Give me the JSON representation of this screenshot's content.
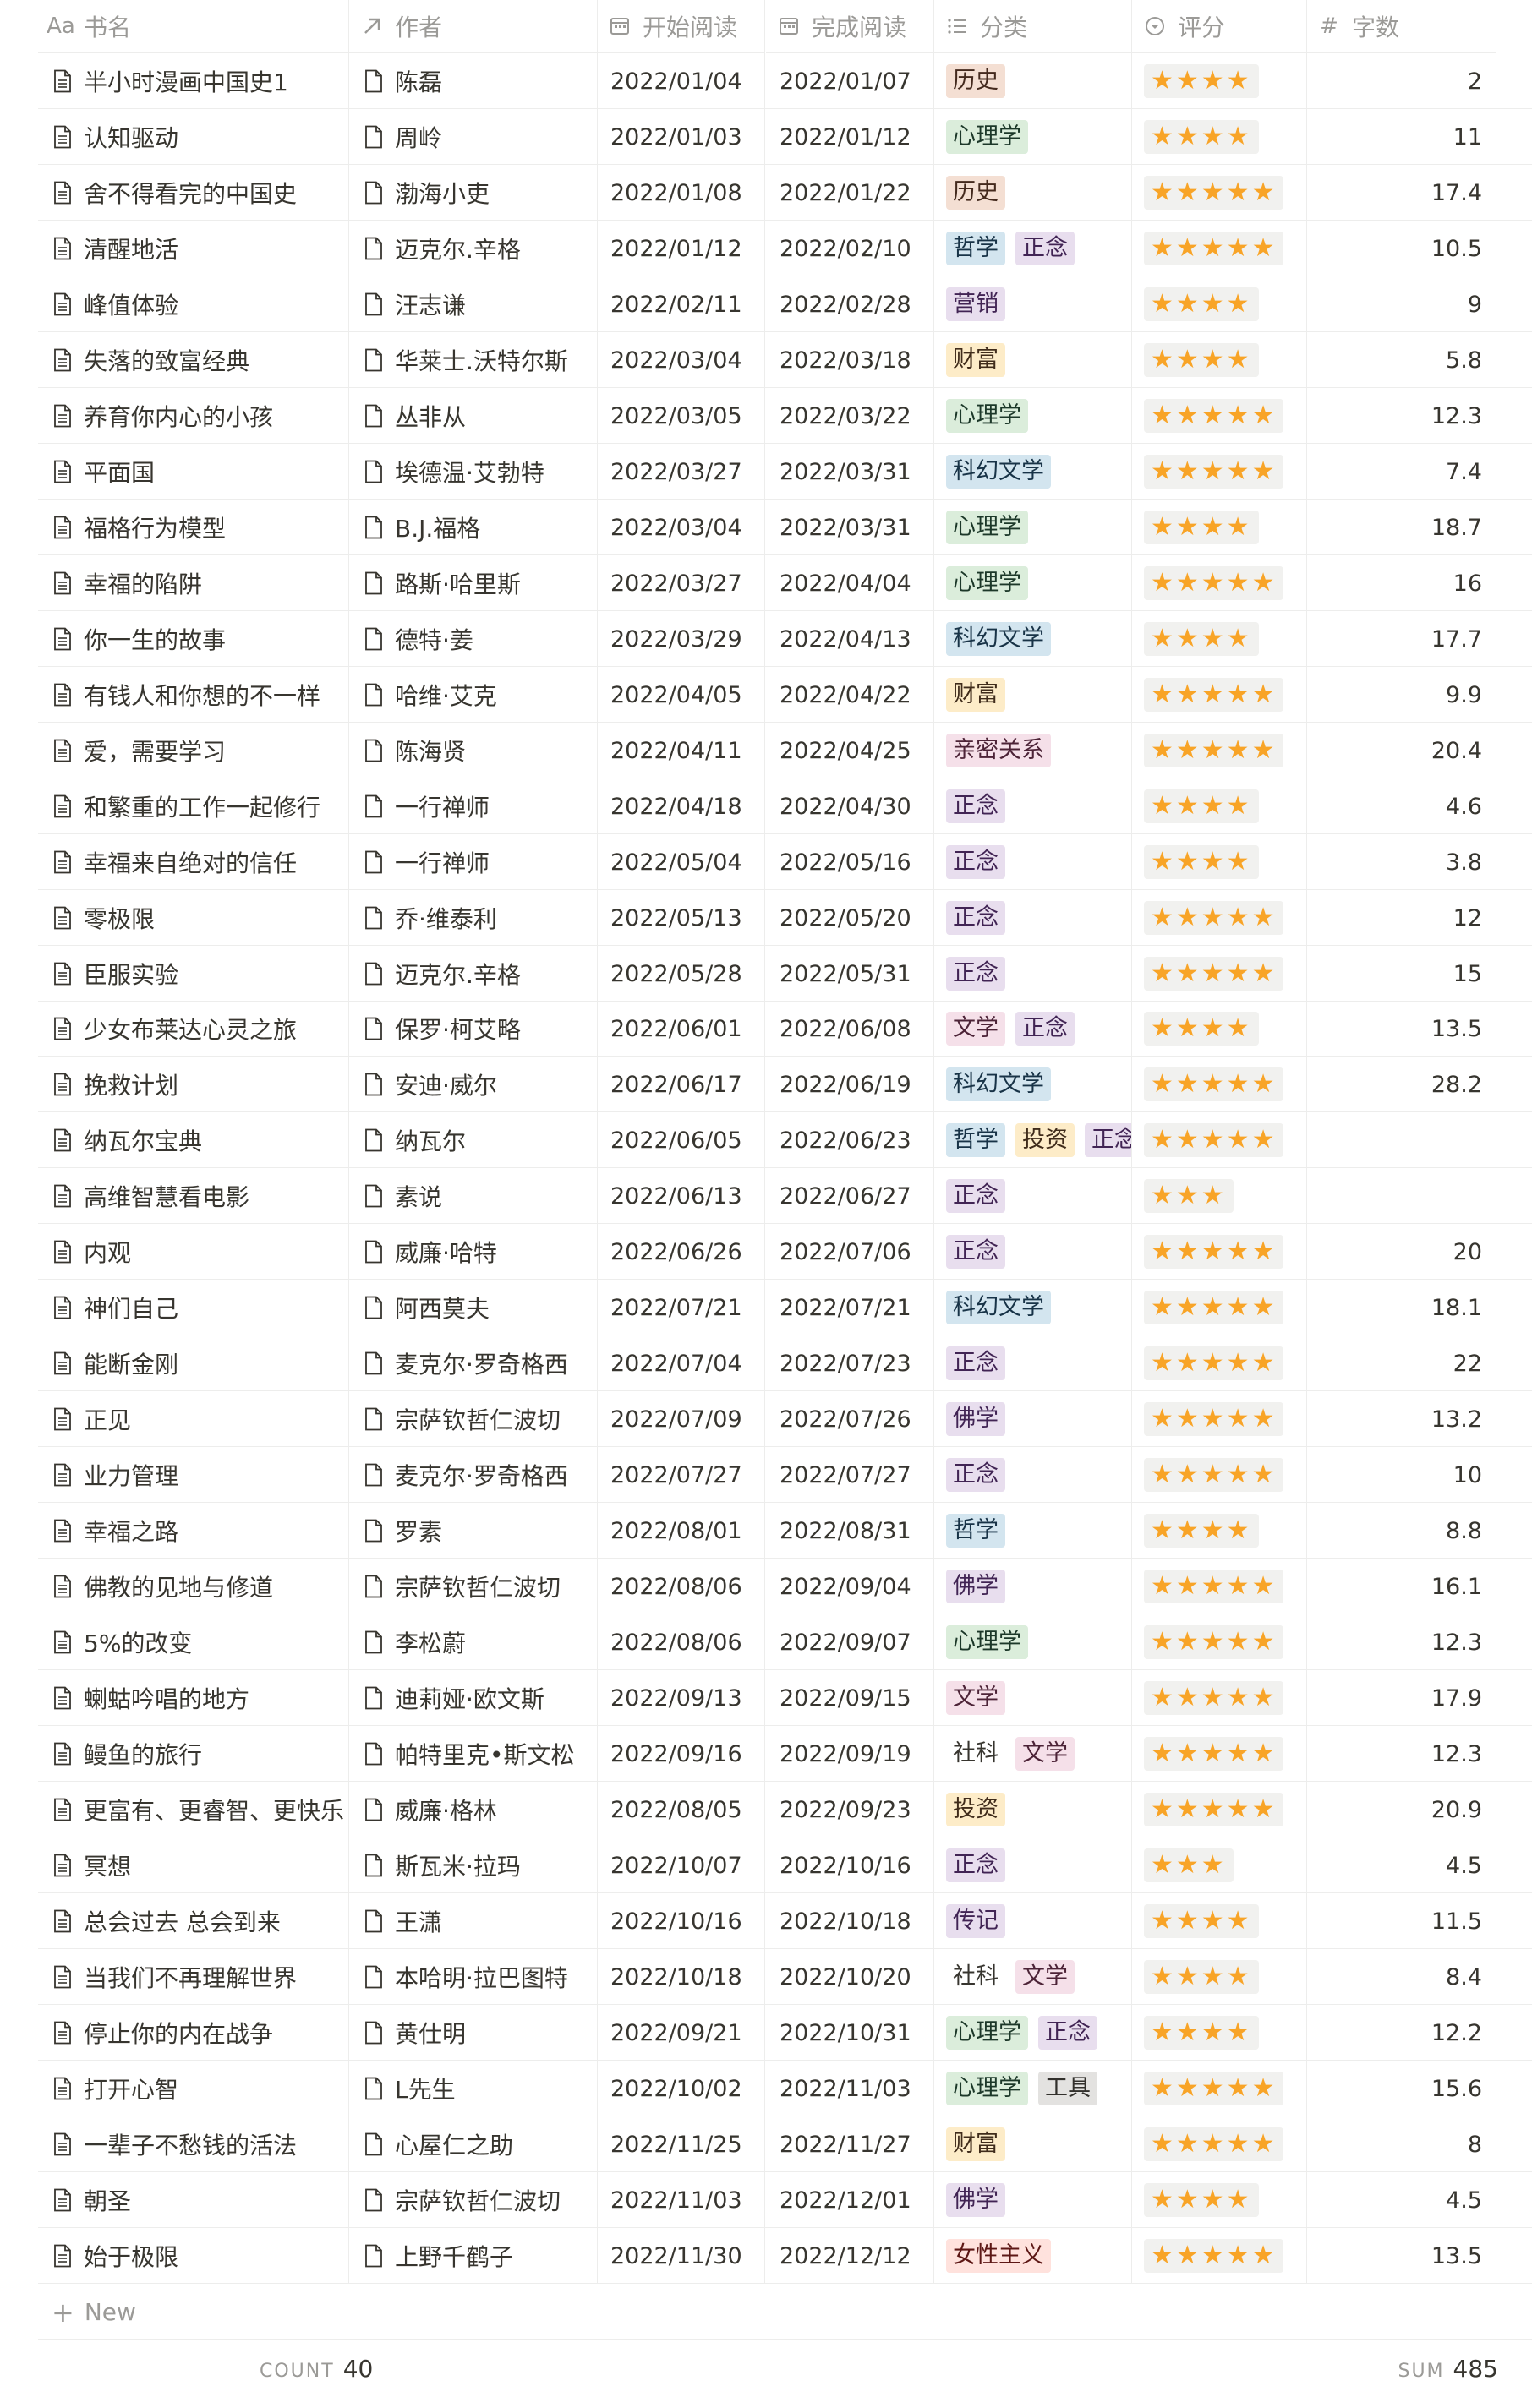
{
  "columns": [
    {
      "key": "title",
      "icon": "text-icon",
      "icon_text": "Aa",
      "label": "书名"
    },
    {
      "key": "author",
      "icon": "relation-arrow-icon",
      "label": "作者"
    },
    {
      "key": "start",
      "icon": "calendar-icon",
      "label": "开始阅读"
    },
    {
      "key": "end",
      "icon": "calendar-icon",
      "label": "完成阅读"
    },
    {
      "key": "category",
      "icon": "list-icon",
      "label": "分类"
    },
    {
      "key": "rating",
      "icon": "select-icon",
      "label": "评分"
    },
    {
      "key": "words",
      "icon": "hash-icon",
      "label": "字数"
    }
  ],
  "tag_colors": {
    "历史": {
      "bg": "#f4dfd3",
      "fg": "#442a1e"
    },
    "心理学": {
      "bg": "#dbeddb",
      "fg": "#1c3829"
    },
    "哲学": {
      "bg": "#d3e5ef",
      "fg": "#183347"
    },
    "正念": {
      "bg": "#e8deee",
      "fg": "#412454"
    },
    "营销": {
      "bg": "#e8deee",
      "fg": "#412454"
    },
    "财富": {
      "bg": "#fdecc8",
      "fg": "#402c1b"
    },
    "科幻文学": {
      "bg": "#d3e5ef",
      "fg": "#183347"
    },
    "亲密关系": {
      "bg": "#f5e0e9",
      "fg": "#4c2337"
    },
    "文学": {
      "bg": "#f5e0e9",
      "fg": "#4c2337"
    },
    "投资": {
      "bg": "#fdecc8",
      "fg": "#402c1b"
    },
    "佛学": {
      "bg": "#e8deee",
      "fg": "#412454"
    },
    "社科": {
      "bg": "#ffffff",
      "fg": "#37352f"
    },
    "传记": {
      "bg": "#e8deee",
      "fg": "#412454"
    },
    "工具": {
      "bg": "#e3e2e0",
      "fg": "#32302c"
    },
    "女性主义": {
      "bg": "#ffe2dd",
      "fg": "#5d1715"
    }
  },
  "rows": [
    {
      "title": "半小时漫画中国史1",
      "author": "陈磊",
      "start": "2022/01/04",
      "end": "2022/01/07",
      "tags": [
        "历史"
      ],
      "stars": "★★★★",
      "rating": 4,
      "words": "2"
    },
    {
      "title": "认知驱动",
      "author": "周岭",
      "start": "2022/01/03",
      "end": "2022/01/12",
      "tags": [
        "心理学"
      ],
      "stars": "★★★★",
      "rating": 4,
      "words": "11"
    },
    {
      "title": "舍不得看完的中国史",
      "author": "渤海小吏",
      "start": "2022/01/08",
      "end": "2022/01/22",
      "tags": [
        "历史"
      ],
      "stars": "★★★★★",
      "rating": 5,
      "words": "17.4"
    },
    {
      "title": "清醒地活",
      "author": "迈克尔.辛格",
      "start": "2022/01/12",
      "end": "2022/02/10",
      "tags": [
        "哲学",
        "正念"
      ],
      "stars": "★★★★★",
      "rating": 5,
      "words": "10.5"
    },
    {
      "title": "峰值体验",
      "author": "汪志谦",
      "start": "2022/02/11",
      "end": "2022/02/28",
      "tags": [
        "营销"
      ],
      "stars": "★★★★",
      "rating": 4,
      "words": "9"
    },
    {
      "title": "失落的致富经典",
      "author": "华莱士.沃特尔斯",
      "start": "2022/03/04",
      "end": "2022/03/18",
      "tags": [
        "财富"
      ],
      "stars": "★★★★",
      "rating": 4,
      "words": "5.8"
    },
    {
      "title": "养育你内心的小孩",
      "author": "丛非从",
      "start": "2022/03/05",
      "end": "2022/03/22",
      "tags": [
        "心理学"
      ],
      "stars": "★★★★★",
      "rating": 5,
      "words": "12.3"
    },
    {
      "title": "平面国",
      "author": "埃德温·艾勃特",
      "start": "2022/03/27",
      "end": "2022/03/31",
      "tags": [
        "科幻文学"
      ],
      "stars": "★★★★★",
      "rating": 5,
      "words": "7.4"
    },
    {
      "title": "福格行为模型",
      "author": "B.J.福格",
      "start": "2022/03/04",
      "end": "2022/03/31",
      "tags": [
        "心理学"
      ],
      "stars": "★★★★",
      "rating": 4,
      "words": "18.7"
    },
    {
      "title": "幸福的陷阱",
      "author": "路斯·哈里斯",
      "start": "2022/03/27",
      "end": "2022/04/04",
      "tags": [
        "心理学"
      ],
      "stars": "★★★★★",
      "rating": 5,
      "words": "16"
    },
    {
      "title": "你一生的故事",
      "author": "德特·姜",
      "start": "2022/03/29",
      "end": "2022/04/13",
      "tags": [
        "科幻文学"
      ],
      "stars": "★★★★",
      "rating": 4,
      "words": "17.7"
    },
    {
      "title": "有钱人和你想的不一样",
      "author": "哈维·艾克",
      "start": "2022/04/05",
      "end": "2022/04/22",
      "tags": [
        "财富"
      ],
      "stars": "★★★★★",
      "rating": 5,
      "words": "9.9"
    },
    {
      "title": "爱，需要学习",
      "author": "陈海贤",
      "start": "2022/04/11",
      "end": "2022/04/25",
      "tags": [
        "亲密关系"
      ],
      "stars": "★★★★★",
      "rating": 5,
      "words": "20.4"
    },
    {
      "title": "和繁重的工作一起修行",
      "author": "一行禅师",
      "start": "2022/04/18",
      "end": "2022/04/30",
      "tags": [
        "正念"
      ],
      "stars": "★★★★",
      "rating": 4,
      "words": "4.6"
    },
    {
      "title": "幸福来自绝对的信任",
      "author": "一行禅师",
      "start": "2022/05/04",
      "end": "2022/05/16",
      "tags": [
        "正念"
      ],
      "stars": "★★★★",
      "rating": 4,
      "words": "3.8"
    },
    {
      "title": "零极限",
      "author": "乔·维泰利",
      "start": "2022/05/13",
      "end": "2022/05/20",
      "tags": [
        "正念"
      ],
      "stars": "★★★★★",
      "rating": 5,
      "words": "12"
    },
    {
      "title": "臣服实验",
      "author": "迈克尔.辛格",
      "start": "2022/05/28",
      "end": "2022/05/31",
      "tags": [
        "正念"
      ],
      "stars": "★★★★★",
      "rating": 5,
      "words": "15"
    },
    {
      "title": "少女布莱达心灵之旅",
      "author": "保罗·柯艾略",
      "start": "2022/06/01",
      "end": "2022/06/08",
      "tags": [
        "文学",
        "正念"
      ],
      "stars": "★★★★",
      "rating": 4,
      "words": "13.5"
    },
    {
      "title": "挽救计划",
      "author": "安迪·威尔",
      "start": "2022/06/17",
      "end": "2022/06/19",
      "tags": [
        "科幻文学"
      ],
      "stars": "★★★★★",
      "rating": 5,
      "words": "28.2"
    },
    {
      "title": "纳瓦尔宝典",
      "author": "纳瓦尔",
      "start": "2022/06/05",
      "end": "2022/06/23",
      "tags": [
        "哲学",
        "投资",
        "正念"
      ],
      "stars": "★★★★★",
      "rating": 5,
      "words": ""
    },
    {
      "title": "高维智慧看电影",
      "author": "素说",
      "start": "2022/06/13",
      "end": "2022/06/27",
      "tags": [
        "正念"
      ],
      "stars": "★★★",
      "rating": 3,
      "words": ""
    },
    {
      "title": "内观",
      "author": "威廉·哈特",
      "start": "2022/06/26",
      "end": "2022/07/06",
      "tags": [
        "正念"
      ],
      "stars": "★★★★★",
      "rating": 5,
      "words": "20"
    },
    {
      "title": "神们自己",
      "author": "阿西莫夫",
      "start": "2022/07/21",
      "end": "2022/07/21",
      "tags": [
        "科幻文学"
      ],
      "stars": "★★★★★",
      "rating": 5,
      "words": "18.1"
    },
    {
      "title": "能断金刚",
      "author": "麦克尔·罗奇格西",
      "start": "2022/07/04",
      "end": "2022/07/23",
      "tags": [
        "正念"
      ],
      "stars": "★★★★★",
      "rating": 5,
      "words": "22"
    },
    {
      "title": "正见",
      "author": "宗萨钦哲仁波切",
      "start": "2022/07/09",
      "end": "2022/07/26",
      "tags": [
        "佛学"
      ],
      "stars": "★★★★★",
      "rating": 5,
      "words": "13.2"
    },
    {
      "title": "业力管理",
      "author": "麦克尔·罗奇格西",
      "start": "2022/07/27",
      "end": "2022/07/27",
      "tags": [
        "正念"
      ],
      "stars": "★★★★★",
      "rating": 5,
      "words": "10"
    },
    {
      "title": "幸福之路",
      "author": "罗素",
      "start": "2022/08/01",
      "end": "2022/08/31",
      "tags": [
        "哲学"
      ],
      "stars": "★★★★",
      "rating": 4,
      "words": "8.8"
    },
    {
      "title": "佛教的见地与修道",
      "author": "宗萨钦哲仁波切",
      "start": "2022/08/06",
      "end": "2022/09/04",
      "tags": [
        "佛学"
      ],
      "stars": "★★★★★",
      "rating": 5,
      "words": "16.1"
    },
    {
      "title": "5%的改变",
      "author": "李松蔚",
      "start": "2022/08/06",
      "end": "2022/09/07",
      "tags": [
        "心理学"
      ],
      "stars": "★★★★★",
      "rating": 5,
      "words": "12.3"
    },
    {
      "title": "蝲蛄吟唱的地方",
      "author": "迪莉娅·欧文斯",
      "start": "2022/09/13",
      "end": "2022/09/15",
      "tags": [
        "文学"
      ],
      "stars": "★★★★★",
      "rating": 5,
      "words": "17.9"
    },
    {
      "title": "鳗鱼的旅行",
      "author": "帕特里克•斯文松",
      "start": "2022/09/16",
      "end": "2022/09/19",
      "tags": [
        "社科",
        "文学"
      ],
      "stars": "★★★★★",
      "rating": 5,
      "words": "12.3"
    },
    {
      "title": "更富有、更睿智、更快乐",
      "author": "威廉·格林",
      "start": "2022/08/05",
      "end": "2022/09/23",
      "tags": [
        "投资"
      ],
      "stars": "★★★★★",
      "rating": 5,
      "words": "20.9"
    },
    {
      "title": "冥想",
      "author": "斯瓦米·拉玛",
      "start": "2022/10/07",
      "end": "2022/10/16",
      "tags": [
        "正念"
      ],
      "stars": "★★★",
      "rating": 3,
      "words": "4.5"
    },
    {
      "title": "总会过去 总会到来",
      "author": "王潇",
      "start": "2022/10/16",
      "end": "2022/10/18",
      "tags": [
        "传记"
      ],
      "stars": "★★★★",
      "rating": 4,
      "words": "11.5"
    },
    {
      "title": "当我们不再理解世界",
      "author": "本哈明·拉巴图特",
      "start": "2022/10/18",
      "end": "2022/10/20",
      "tags": [
        "社科",
        "文学"
      ],
      "stars": "★★★★",
      "rating": 4,
      "words": "8.4"
    },
    {
      "title": "停止你的内在战争",
      "author": "黄仕明",
      "start": "2022/09/21",
      "end": "2022/10/31",
      "tags": [
        "心理学",
        "正念"
      ],
      "stars": "★★★★",
      "rating": 4,
      "words": "12.2"
    },
    {
      "title": "打开心智",
      "author": "L先生",
      "start": "2022/10/02",
      "end": "2022/11/03",
      "tags": [
        "心理学",
        "工具"
      ],
      "stars": "★★★★★",
      "rating": 5,
      "words": "15.6"
    },
    {
      "title": "一辈子不愁钱的活法",
      "author": "心屋仁之助",
      "start": "2022/11/25",
      "end": "2022/11/27",
      "tags": [
        "财富"
      ],
      "stars": "★★★★★",
      "rating": 5,
      "words": "8"
    },
    {
      "title": "朝圣",
      "author": "宗萨钦哲仁波切",
      "start": "2022/11/03",
      "end": "2022/12/01",
      "tags": [
        "佛学"
      ],
      "stars": "★★★★",
      "rating": 4,
      "words": "4.5"
    },
    {
      "title": "始于极限",
      "author": "上野千鹤子",
      "start": "2022/11/30",
      "end": "2022/12/12",
      "tags": [
        "女性主义"
      ],
      "stars": "★★★★★",
      "rating": 5,
      "words": "13.5"
    }
  ],
  "new_row": {
    "plus": "+",
    "label": "New"
  },
  "footer": {
    "count_label": "COUNT",
    "count_value": "40",
    "sum_label": "SUM",
    "sum_value": "485"
  }
}
